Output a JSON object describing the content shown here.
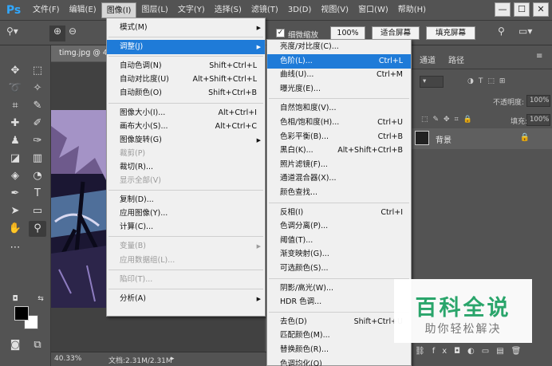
{
  "app": {
    "logo": "Ps"
  },
  "menubar": {
    "items": [
      "文件(F)",
      "编辑(E)",
      "图像(I)",
      "图层(L)",
      "文字(Y)",
      "选择(S)",
      "滤镜(T)",
      "3D(D)",
      "视图(V)",
      "窗口(W)",
      "帮助(H)"
    ],
    "active_index": 2
  },
  "window_buttons": {
    "minimize": "—",
    "restore": "☐",
    "close": "✕"
  },
  "options_bar": {
    "scrubby_zoom_label": "细微缩放",
    "zoom_100_button": "100%",
    "fit_screen_button": "适合屏幕",
    "fill_screen_button": "填充屏幕"
  },
  "document": {
    "tab_title": "timg.jpg @ 4"
  },
  "statusbar": {
    "zoom": "40.33%",
    "doc_info": "文档:2.31M/2.31M"
  },
  "panels": {
    "tabs": [
      "通道",
      "路径"
    ],
    "opacity_label": "不透明度:",
    "opacity_value": "100%",
    "fill_label": "填充:",
    "fill_value": "100%",
    "layer_name": "背景"
  },
  "image_menu": {
    "items": [
      {
        "label": "模式(M)",
        "submenu": true,
        "shortcut": "",
        "disabled": false
      },
      {
        "separator": true
      },
      {
        "label": "调整(J)",
        "submenu": true,
        "shortcut": "",
        "disabled": false,
        "highlighted": true
      },
      {
        "separator": true
      },
      {
        "label": "自动色调(N)",
        "shortcut": "Shift+Ctrl+L",
        "disabled": false
      },
      {
        "label": "自动对比度(U)",
        "shortcut": "Alt+Shift+Ctrl+L",
        "disabled": false
      },
      {
        "label": "自动颜色(O)",
        "shortcut": "Shift+Ctrl+B",
        "disabled": false
      },
      {
        "separator": true
      },
      {
        "label": "图像大小(I)...",
        "shortcut": "Alt+Ctrl+I",
        "disabled": false
      },
      {
        "label": "画布大小(S)...",
        "shortcut": "Alt+Ctrl+C",
        "disabled": false
      },
      {
        "label": "图像旋转(G)",
        "submenu": true,
        "shortcut": "",
        "disabled": false
      },
      {
        "label": "裁剪(P)",
        "shortcut": "",
        "disabled": true
      },
      {
        "label": "裁切(R)...",
        "shortcut": "",
        "disabled": false
      },
      {
        "label": "显示全部(V)",
        "shortcut": "",
        "disabled": true
      },
      {
        "separator": true
      },
      {
        "label": "复制(D)...",
        "shortcut": "",
        "disabled": false
      },
      {
        "label": "应用图像(Y)...",
        "shortcut": "",
        "disabled": false
      },
      {
        "label": "计算(C)...",
        "shortcut": "",
        "disabled": false
      },
      {
        "separator": true
      },
      {
        "label": "变量(B)",
        "submenu": true,
        "shortcut": "",
        "disabled": true
      },
      {
        "label": "应用数据组(L)...",
        "shortcut": "",
        "disabled": true
      },
      {
        "separator": true
      },
      {
        "label": "陷印(T)...",
        "shortcut": "",
        "disabled": true
      },
      {
        "separator": true
      },
      {
        "label": "分析(A)",
        "submenu": true,
        "shortcut": "",
        "disabled": false
      }
    ]
  },
  "adjust_menu": {
    "items": [
      {
        "label": "亮度/对比度(C)...",
        "shortcut": ""
      },
      {
        "label": "色阶(L)...",
        "shortcut": "Ctrl+L",
        "highlighted": true
      },
      {
        "label": "曲线(U)...",
        "shortcut": "Ctrl+M"
      },
      {
        "label": "曝光度(E)...",
        "shortcut": ""
      },
      {
        "separator": true
      },
      {
        "label": "自然饱和度(V)...",
        "shortcut": ""
      },
      {
        "label": "色相/饱和度(H)...",
        "shortcut": "Ctrl+U"
      },
      {
        "label": "色彩平衡(B)...",
        "shortcut": "Ctrl+B"
      },
      {
        "label": "黑白(K)...",
        "shortcut": "Alt+Shift+Ctrl+B"
      },
      {
        "label": "照片滤镜(F)...",
        "shortcut": ""
      },
      {
        "label": "通道混合器(X)...",
        "shortcut": ""
      },
      {
        "label": "颜色查找...",
        "shortcut": ""
      },
      {
        "separator": true
      },
      {
        "label": "反相(I)",
        "shortcut": "Ctrl+I"
      },
      {
        "label": "色调分离(P)...",
        "shortcut": ""
      },
      {
        "label": "阈值(T)...",
        "shortcut": ""
      },
      {
        "label": "渐变映射(G)...",
        "shortcut": ""
      },
      {
        "label": "可选颜色(S)...",
        "shortcut": ""
      },
      {
        "separator": true
      },
      {
        "label": "阴影/高光(W)...",
        "shortcut": ""
      },
      {
        "label": "HDR 色调...",
        "shortcut": ""
      },
      {
        "separator": true
      },
      {
        "label": "去色(D)",
        "shortcut": "Shift+Ctrl+U"
      },
      {
        "label": "匹配颜色(M)...",
        "shortcut": ""
      },
      {
        "label": "替换颜色(R)...",
        "shortcut": ""
      },
      {
        "label": "色调均化(Q)",
        "shortcut": ""
      }
    ]
  },
  "watermark": {
    "title": "百科全说",
    "subtitle": "助你轻松解决"
  },
  "colors": {
    "highlight": "#1f7bd8",
    "ps_blue": "#31a8ff",
    "watermark_green": "#2aa56b"
  }
}
